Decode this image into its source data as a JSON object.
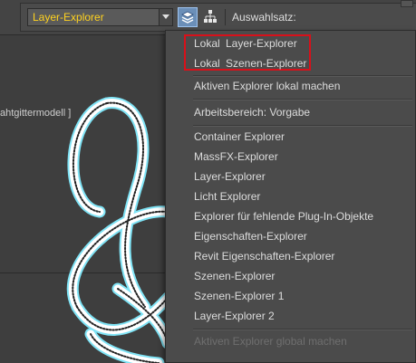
{
  "toolbar": {
    "explorer_select_value": "Layer-Explorer",
    "selection_set_label": "Auswahlsatz:",
    "icons": [
      "chevron-down-icon",
      "layers-explorer-icon",
      "hierarchy-icon"
    ]
  },
  "viewport": {
    "label": "ahtgittermodell ]"
  },
  "menu": {
    "local_items": [
      {
        "prefix": "Lokal",
        "label": "Layer-Explorer"
      },
      {
        "prefix": "Lokal",
        "label": "Szenen-Explorer"
      }
    ],
    "make_local": "Aktiven Explorer lokal machen",
    "workspace": "Arbeitsbereich: Vorgabe",
    "explorers": [
      "Container Explorer",
      "MassFX-Explorer",
      "Layer-Explorer",
      "Licht Explorer",
      "Explorer für fehlende Plug-In-Objekte",
      "Eigenschaften-Explorer",
      "Revit Eigenschaften-Explorer",
      "Szenen-Explorer",
      "Szenen-Explorer 1",
      "Layer-Explorer 2"
    ],
    "make_global": "Aktiven Explorer global machen"
  },
  "colors": {
    "accent_yellow": "#ffd21f",
    "highlight_red": "#d8101a",
    "wire_cyan": "#7fe3f5"
  }
}
